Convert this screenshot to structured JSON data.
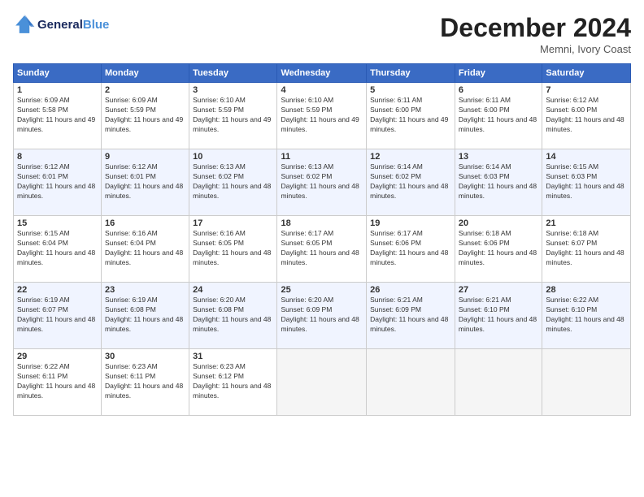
{
  "header": {
    "logo_line1": "General",
    "logo_line2": "Blue",
    "month_title": "December 2024",
    "subtitle": "Memni, Ivory Coast"
  },
  "days_of_week": [
    "Sunday",
    "Monday",
    "Tuesday",
    "Wednesday",
    "Thursday",
    "Friday",
    "Saturday"
  ],
  "weeks": [
    [
      {
        "day": "1",
        "sunrise": "6:09 AM",
        "sunset": "5:58 PM",
        "daylight": "11 hours and 49 minutes."
      },
      {
        "day": "2",
        "sunrise": "6:09 AM",
        "sunset": "5:59 PM",
        "daylight": "11 hours and 49 minutes."
      },
      {
        "day": "3",
        "sunrise": "6:10 AM",
        "sunset": "5:59 PM",
        "daylight": "11 hours and 49 minutes."
      },
      {
        "day": "4",
        "sunrise": "6:10 AM",
        "sunset": "5:59 PM",
        "daylight": "11 hours and 49 minutes."
      },
      {
        "day": "5",
        "sunrise": "6:11 AM",
        "sunset": "6:00 PM",
        "daylight": "11 hours and 49 minutes."
      },
      {
        "day": "6",
        "sunrise": "6:11 AM",
        "sunset": "6:00 PM",
        "daylight": "11 hours and 48 minutes."
      },
      {
        "day": "7",
        "sunrise": "6:12 AM",
        "sunset": "6:00 PM",
        "daylight": "11 hours and 48 minutes."
      }
    ],
    [
      {
        "day": "8",
        "sunrise": "6:12 AM",
        "sunset": "6:01 PM",
        "daylight": "11 hours and 48 minutes."
      },
      {
        "day": "9",
        "sunrise": "6:12 AM",
        "sunset": "6:01 PM",
        "daylight": "11 hours and 48 minutes."
      },
      {
        "day": "10",
        "sunrise": "6:13 AM",
        "sunset": "6:02 PM",
        "daylight": "11 hours and 48 minutes."
      },
      {
        "day": "11",
        "sunrise": "6:13 AM",
        "sunset": "6:02 PM",
        "daylight": "11 hours and 48 minutes."
      },
      {
        "day": "12",
        "sunrise": "6:14 AM",
        "sunset": "6:02 PM",
        "daylight": "11 hours and 48 minutes."
      },
      {
        "day": "13",
        "sunrise": "6:14 AM",
        "sunset": "6:03 PM",
        "daylight": "11 hours and 48 minutes."
      },
      {
        "day": "14",
        "sunrise": "6:15 AM",
        "sunset": "6:03 PM",
        "daylight": "11 hours and 48 minutes."
      }
    ],
    [
      {
        "day": "15",
        "sunrise": "6:15 AM",
        "sunset": "6:04 PM",
        "daylight": "11 hours and 48 minutes."
      },
      {
        "day": "16",
        "sunrise": "6:16 AM",
        "sunset": "6:04 PM",
        "daylight": "11 hours and 48 minutes."
      },
      {
        "day": "17",
        "sunrise": "6:16 AM",
        "sunset": "6:05 PM",
        "daylight": "11 hours and 48 minutes."
      },
      {
        "day": "18",
        "sunrise": "6:17 AM",
        "sunset": "6:05 PM",
        "daylight": "11 hours and 48 minutes."
      },
      {
        "day": "19",
        "sunrise": "6:17 AM",
        "sunset": "6:06 PM",
        "daylight": "11 hours and 48 minutes."
      },
      {
        "day": "20",
        "sunrise": "6:18 AM",
        "sunset": "6:06 PM",
        "daylight": "11 hours and 48 minutes."
      },
      {
        "day": "21",
        "sunrise": "6:18 AM",
        "sunset": "6:07 PM",
        "daylight": "11 hours and 48 minutes."
      }
    ],
    [
      {
        "day": "22",
        "sunrise": "6:19 AM",
        "sunset": "6:07 PM",
        "daylight": "11 hours and 48 minutes."
      },
      {
        "day": "23",
        "sunrise": "6:19 AM",
        "sunset": "6:08 PM",
        "daylight": "11 hours and 48 minutes."
      },
      {
        "day": "24",
        "sunrise": "6:20 AM",
        "sunset": "6:08 PM",
        "daylight": "11 hours and 48 minutes."
      },
      {
        "day": "25",
        "sunrise": "6:20 AM",
        "sunset": "6:09 PM",
        "daylight": "11 hours and 48 minutes."
      },
      {
        "day": "26",
        "sunrise": "6:21 AM",
        "sunset": "6:09 PM",
        "daylight": "11 hours and 48 minutes."
      },
      {
        "day": "27",
        "sunrise": "6:21 AM",
        "sunset": "6:10 PM",
        "daylight": "11 hours and 48 minutes."
      },
      {
        "day": "28",
        "sunrise": "6:22 AM",
        "sunset": "6:10 PM",
        "daylight": "11 hours and 48 minutes."
      }
    ],
    [
      {
        "day": "29",
        "sunrise": "6:22 AM",
        "sunset": "6:11 PM",
        "daylight": "11 hours and 48 minutes."
      },
      {
        "day": "30",
        "sunrise": "6:23 AM",
        "sunset": "6:11 PM",
        "daylight": "11 hours and 48 minutes."
      },
      {
        "day": "31",
        "sunrise": "6:23 AM",
        "sunset": "6:12 PM",
        "daylight": "11 hours and 48 minutes."
      },
      null,
      null,
      null,
      null
    ]
  ]
}
